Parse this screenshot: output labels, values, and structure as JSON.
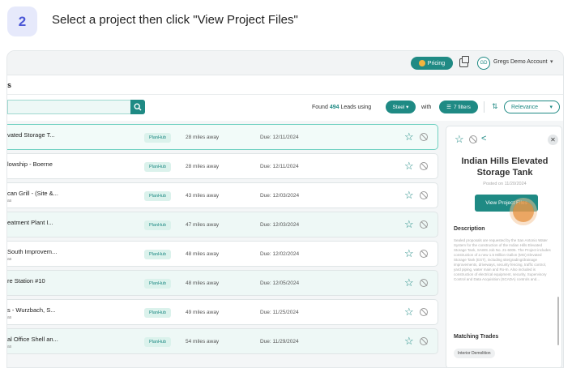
{
  "step": {
    "number": "2",
    "instruction": "Select a project then click \"View Project Files\""
  },
  "topbar": {
    "pricing_label": "Pricing",
    "avatar_initials": "GD",
    "account_name": "Gregs Demo Account",
    "caret": "▾"
  },
  "page": {
    "title": "s"
  },
  "toolbar": {
    "search_value": "",
    "found_prefix": "Found",
    "found_count": "494",
    "found_suffix": "Leads using",
    "steel_label": "Steel ▾",
    "with_label": "with",
    "filters_label": "7 filters",
    "relevance_label": "Relevance",
    "relevance_caret": "▾"
  },
  "rows": [
    {
      "title": "vated Storage T...",
      "sub": "",
      "tag": "PlanHub",
      "distance": "28 miles away",
      "due": "Due: 12/11/2024"
    },
    {
      "title": "lowship - Boerne",
      "sub": "",
      "tag": "PlanHub",
      "distance": "28 miles away",
      "due": "Due: 12/11/2024"
    },
    {
      "title": "can Grill - (Site &...",
      "sub": "as",
      "tag": "PlanHub",
      "distance": "43 miles away",
      "due": "Due: 12/03/2024"
    },
    {
      "title": "eatment Plant I...",
      "sub": "",
      "tag": "PlanHub",
      "distance": "47 miles away",
      "due": "Due: 12/03/2024"
    },
    {
      "title": "South Improvem...",
      "sub": "as",
      "tag": "PlanHub",
      "distance": "48 miles away",
      "due": "Due: 12/02/2024"
    },
    {
      "title": "re Station #10",
      "sub": "",
      "tag": "PlanHub",
      "distance": "48 miles away",
      "due": "Due: 12/05/2024"
    },
    {
      "title": "s - Wurzbach, S...",
      "sub": "as",
      "tag": "PlanHub",
      "distance": "49 miles away",
      "due": "Due: 11/25/2024"
    },
    {
      "title": "al Office Shell an...",
      "sub": "as",
      "tag": "PlanHub",
      "distance": "54 miles away",
      "due": "Due: 11/29/2024"
    }
  ],
  "panel": {
    "title": "Indian Hills Elevated Storage Tank",
    "posted": "Posted on 11/20/2024",
    "view_button": "View Project Files",
    "description_heading": "Description",
    "description": "Sealed proposals are requested by the San Antonio Water System for the construction of the Indian Hills Elevated Storage Tank, SAWS Job No. 21-6005. The Project includes construction of a new 1.5 Million Gallon (MG) Elevated Storage Tank (EST), including site/grading/drainage improvements, driveways, security fencing, traffic control, yard piping, water main and Ro-In. Also included is construction of electrical equipment, security, Supervisory Control and Data Acquisition (SCADA) controls and...",
    "trades_heading": "Matching Trades",
    "trade_chip": "Interior Demolition"
  }
}
